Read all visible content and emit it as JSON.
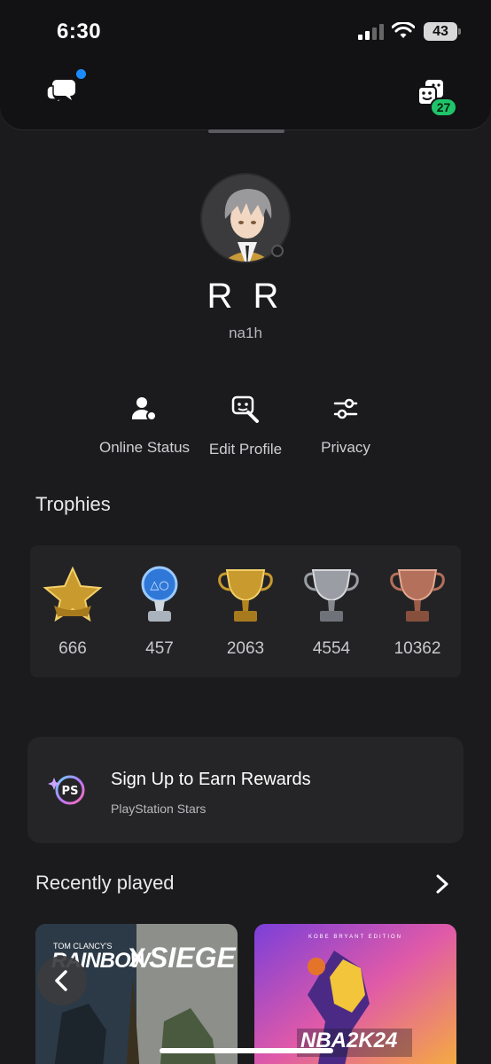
{
  "status_bar": {
    "time": "6:30",
    "battery": "43"
  },
  "header": {
    "party_count": "27"
  },
  "profile": {
    "display_name": "R R",
    "online_id": "na1h"
  },
  "actions": [
    {
      "label": "Online Status",
      "icon": "online-status-icon"
    },
    {
      "label": "Edit Profile",
      "icon": "edit-profile-icon"
    },
    {
      "label": "Privacy",
      "icon": "privacy-sliders-icon"
    }
  ],
  "trophies": {
    "title": "Trophies",
    "items": [
      {
        "type": "level",
        "count": "666"
      },
      {
        "type": "platinum",
        "count": "457"
      },
      {
        "type": "gold",
        "count": "2063"
      },
      {
        "type": "silver",
        "count": "4554"
      },
      {
        "type": "bronze",
        "count": "10362"
      }
    ]
  },
  "stars": {
    "title": "Sign Up to Earn Rewards",
    "subtitle": "PlayStation Stars"
  },
  "recently_played": {
    "title": "Recently played",
    "games": [
      {
        "brand": "TOM CLANCY'S",
        "title_a": "RAINBOW",
        "title_b": "SIEGE",
        "logo_x": "X"
      },
      {
        "edition": "KOBE BRYANT EDITION",
        "title": "NBA2K24"
      }
    ]
  },
  "colors": {
    "accent_blue": "#1a8cff",
    "badge_green": "#1fc46a",
    "background": "#1b1b1d"
  }
}
